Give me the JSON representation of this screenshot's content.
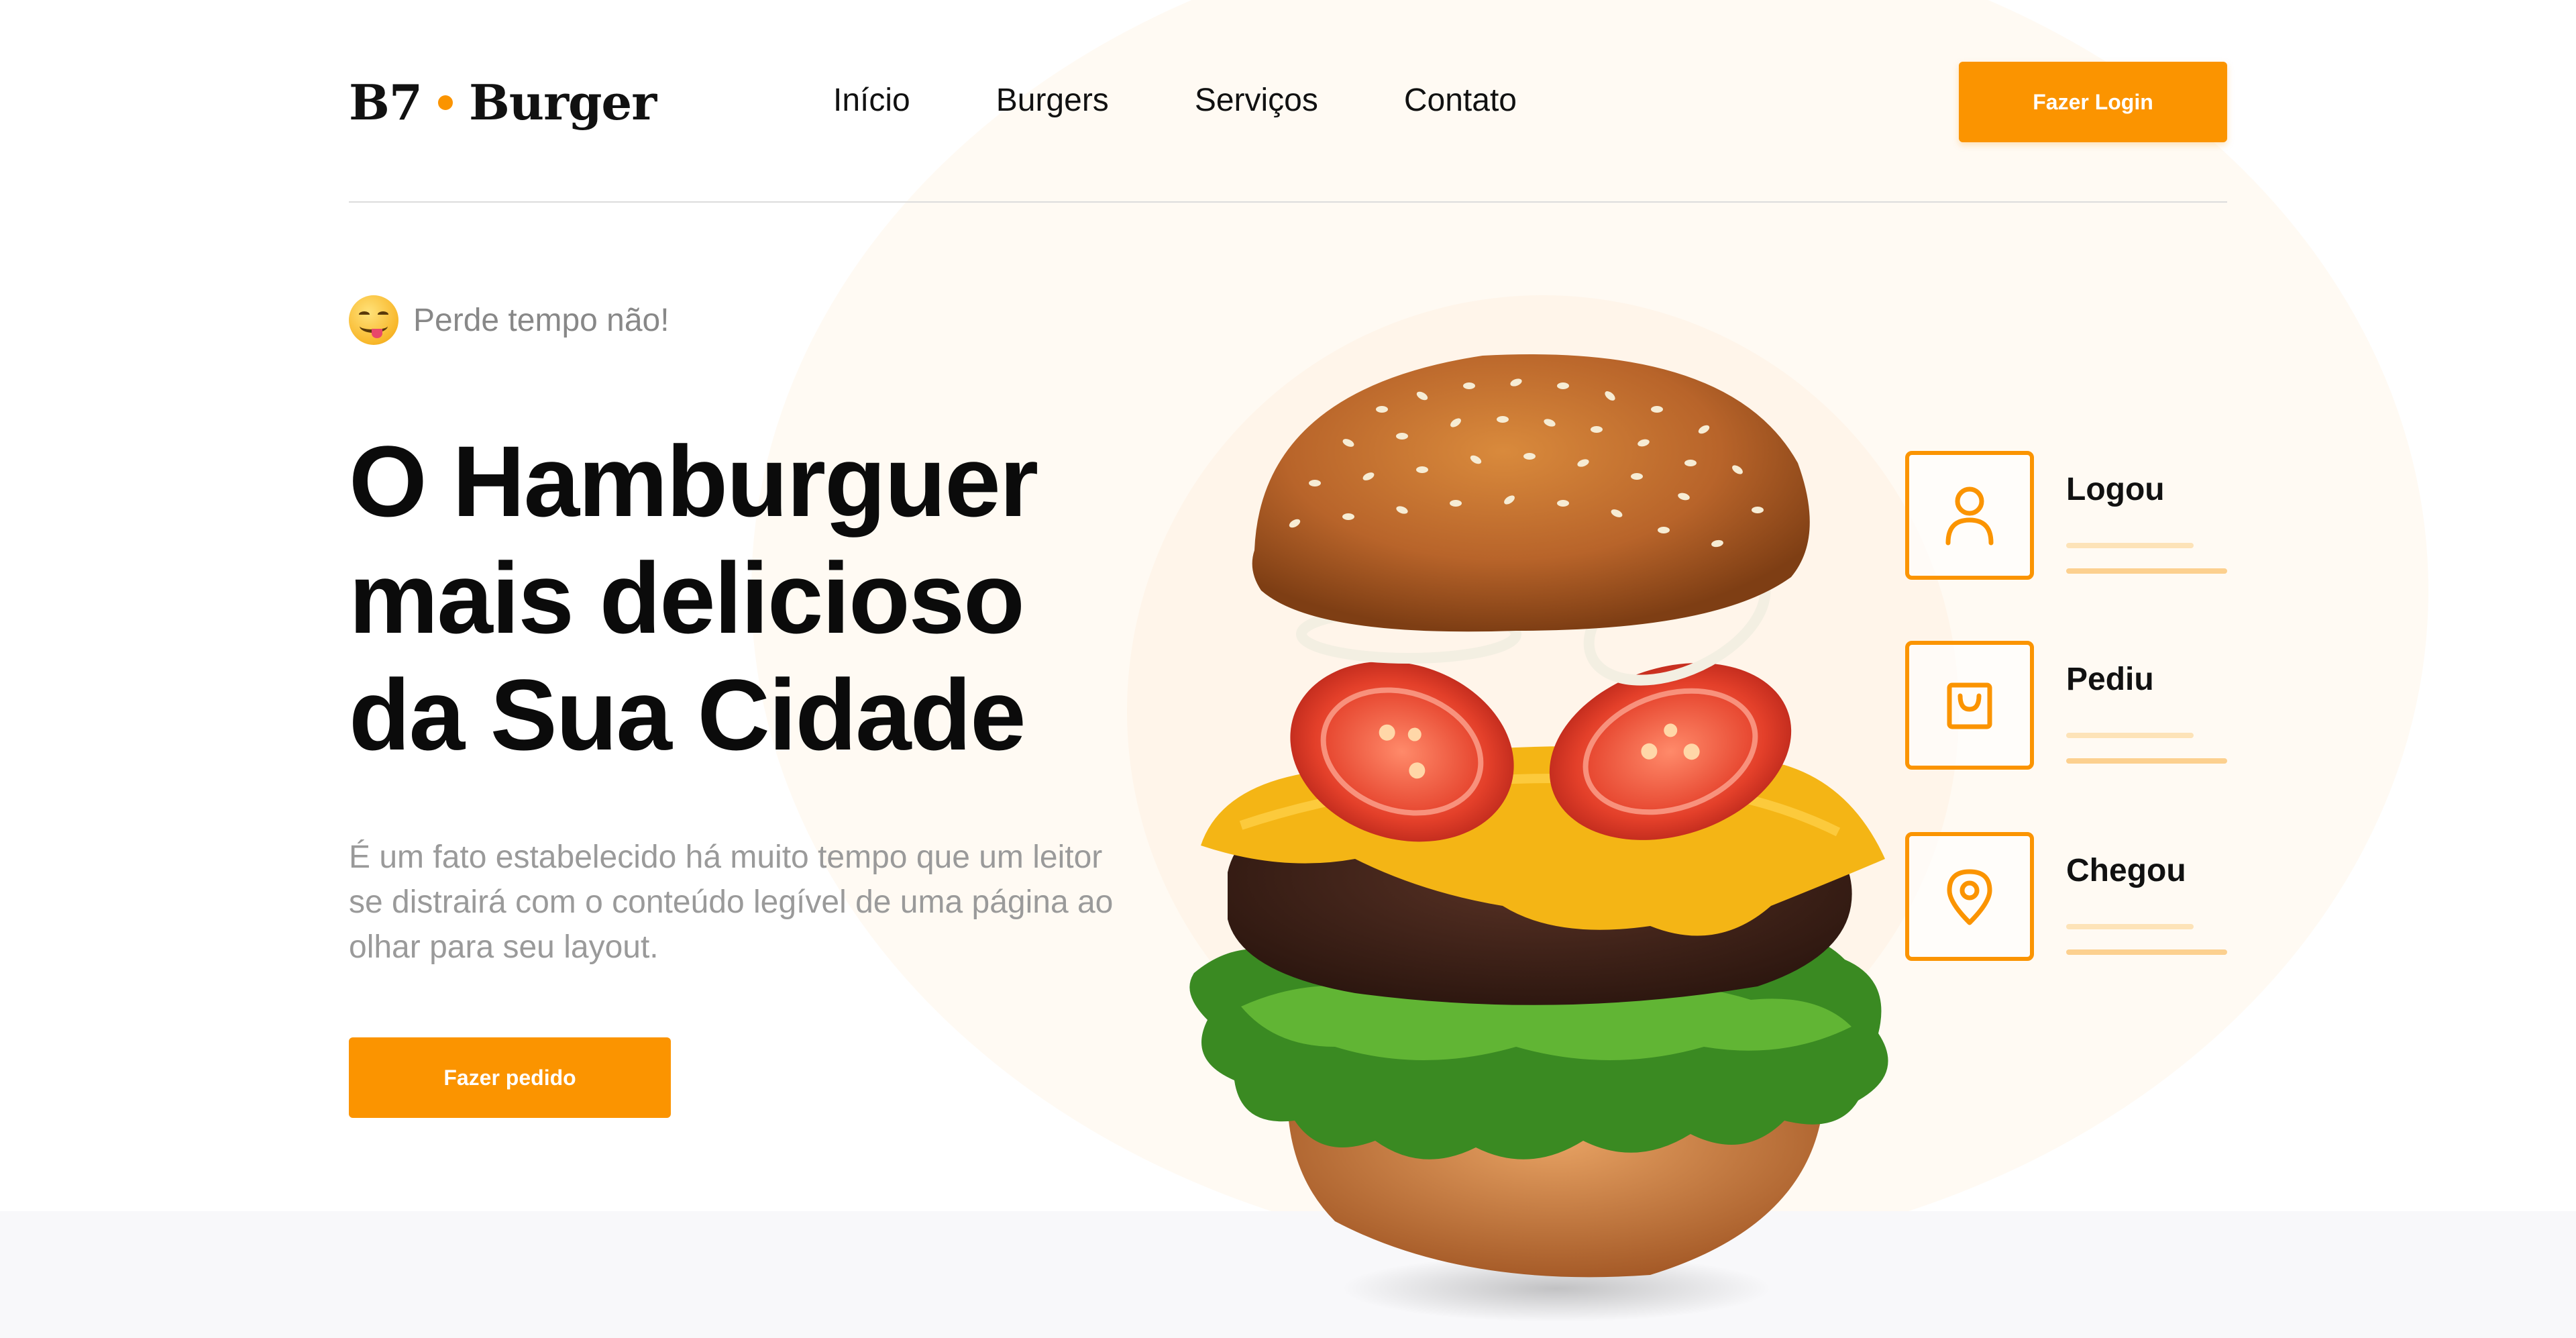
{
  "header": {
    "logo_left": "B7",
    "logo_right": "Burger",
    "nav": [
      {
        "label": "Início"
      },
      {
        "label": "Burgers"
      },
      {
        "label": "Serviços"
      },
      {
        "label": "Contato"
      }
    ],
    "login_button": "Fazer Login"
  },
  "hero": {
    "emoji_icon": "yum-face-emoji-icon",
    "tagline": "Perde tempo não!",
    "title_lines": [
      "O Hamburguer",
      "mais delicioso",
      "da Sua Cidade"
    ],
    "description": "É um fato estabelecido há muito tempo que um leitor se distrairá com o conteúdo legível de uma página ao olhar para seu layout.",
    "order_button": "Fazer pedido"
  },
  "steps": [
    {
      "label": "Logou",
      "icon": "user-icon"
    },
    {
      "label": "Pediu",
      "icon": "shopping-bag-icon"
    },
    {
      "label": "Chegou",
      "icon": "location-pin-icon"
    }
  ],
  "colors": {
    "accent": "#fb9400",
    "text": "#111111",
    "muted": "#9a9a9a"
  }
}
